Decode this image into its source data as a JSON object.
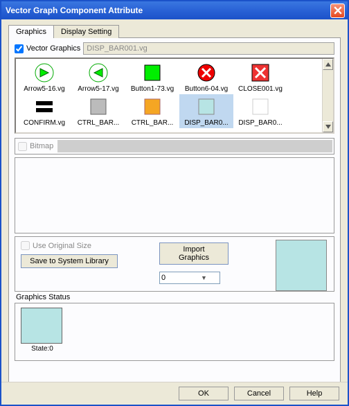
{
  "title": "Vector Graph Component Attribute",
  "tabs": {
    "graphics": "Graphics",
    "display": "Display Setting"
  },
  "vectorGraphics": {
    "label": "Vector Graphics",
    "checked": true,
    "file": "DISP_BAR001.vg"
  },
  "gallery": [
    {
      "name": "Arrow5-16.vg"
    },
    {
      "name": "Arrow5-17.vg"
    },
    {
      "name": "Button1-73.vg"
    },
    {
      "name": "Button6-04.vg"
    },
    {
      "name": "CLOSE001.vg"
    },
    {
      "name": "CONFIRM.vg"
    },
    {
      "name": "CTRL_BAR..."
    },
    {
      "name": "CTRL_BAR..."
    },
    {
      "name": "DISP_BAR0..."
    },
    {
      "name": "DISP_BAR0..."
    }
  ],
  "bitmap": {
    "label": "Bitmap"
  },
  "useOriginalSize": "Use Original Size",
  "saveToLibrary": "Save to System Library",
  "importGraphics": "Import Graphics",
  "selectValue": "0",
  "graphicsStatus": "Graphics Status",
  "state": "State:0",
  "buttons": {
    "ok": "OK",
    "cancel": "Cancel",
    "help": "Help"
  }
}
